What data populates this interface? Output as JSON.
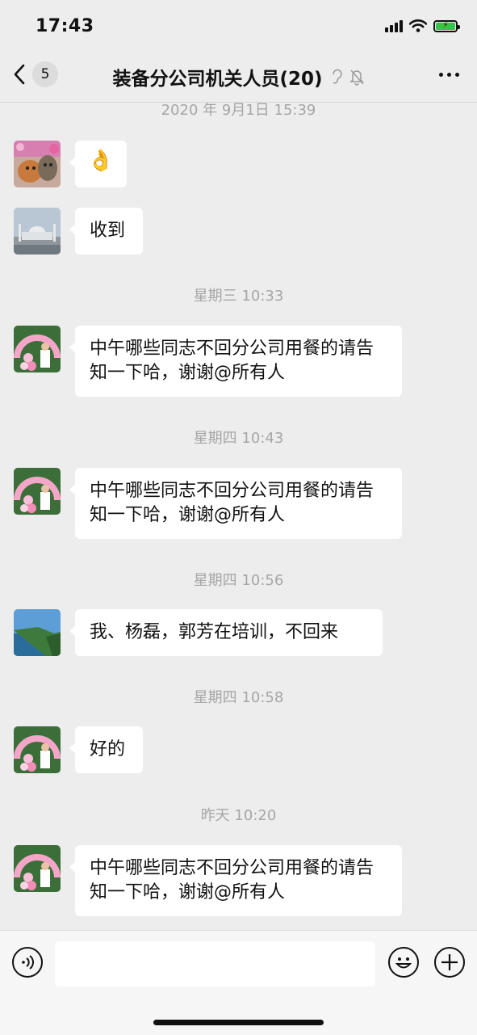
{
  "status_bar": {
    "time": "17:43",
    "battery_charging_icon": "lightning-icon"
  },
  "nav": {
    "unread_count": "5",
    "title": "装备分公司机关人员(20)"
  },
  "messages": [
    {
      "type": "timestamp",
      "text": "2020 年 9月1日 15:39"
    },
    {
      "type": "message",
      "avatar": "cat-photo-avatar",
      "text": "👌"
    },
    {
      "type": "message",
      "avatar": "mosque-photo-avatar",
      "text": "收到"
    },
    {
      "type": "timestamp",
      "text": "星期三 10:33"
    },
    {
      "type": "message",
      "avatar": "balloon-arch-avatar",
      "text": "中午哪些同志不回分公司用餐的请告知一下哈，谢谢@所有人"
    },
    {
      "type": "timestamp",
      "text": "星期四 10:43"
    },
    {
      "type": "message",
      "avatar": "balloon-arch-avatar",
      "text": "中午哪些同志不回分公司用餐的请告知一下哈，谢谢@所有人"
    },
    {
      "type": "timestamp",
      "text": "星期四 10:56"
    },
    {
      "type": "message",
      "avatar": "coast-photo-avatar",
      "text": "我、杨磊，郭芳在培训，不回来"
    },
    {
      "type": "timestamp",
      "text": "星期四 10:58"
    },
    {
      "type": "message",
      "avatar": "balloon-arch-avatar",
      "text": "好的"
    },
    {
      "type": "timestamp",
      "text": "昨天 10:20"
    },
    {
      "type": "message",
      "avatar": "balloon-arch-avatar",
      "text": "中午哪些同志不回分公司用餐的请告知一下哈，谢谢@所有人"
    }
  ],
  "input": {
    "placeholder": ""
  },
  "colors": {
    "background": "#ededed",
    "bubble": "#ffffff",
    "timestamp": "#a6a6a6",
    "battery": "#37c34b"
  }
}
